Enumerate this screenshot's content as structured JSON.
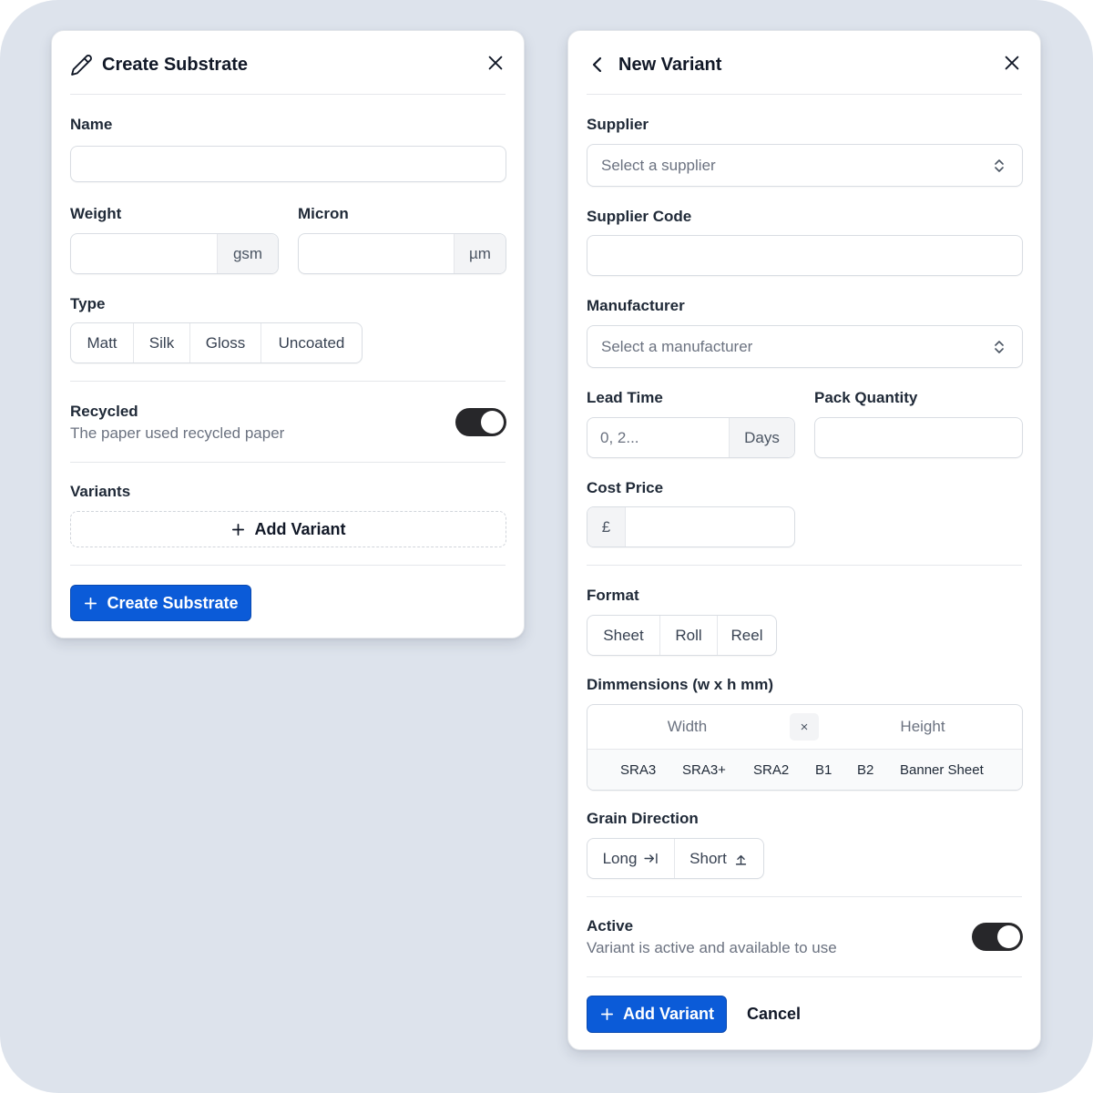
{
  "colors": {
    "background": "#dde3ec",
    "primary": "#0b5bd8",
    "toggle_on": "#27272a"
  },
  "create_substrate": {
    "title": "Create Substrate",
    "icons": {
      "title": "pencil-icon",
      "close": "close-icon"
    },
    "name": {
      "label": "Name",
      "value": ""
    },
    "weight": {
      "label": "Weight",
      "value": "",
      "unit": "gsm"
    },
    "micron": {
      "label": "Micron",
      "value": "",
      "unit": "µm"
    },
    "type": {
      "label": "Type",
      "options": [
        "Matt",
        "Silk",
        "Gloss",
        "Uncoated"
      ]
    },
    "recycled": {
      "label": "Recycled",
      "description": "The paper used recycled paper",
      "enabled": true
    },
    "variants": {
      "label": "Variants",
      "add_label": "Add Variant"
    },
    "submit_label": "Create Substrate"
  },
  "new_variant": {
    "title": "New Variant",
    "icons": {
      "back": "chevron-left-icon",
      "close": "close-icon"
    },
    "supplier": {
      "label": "Supplier",
      "placeholder": "Select a supplier"
    },
    "supplier_code": {
      "label": "Supplier Code",
      "value": ""
    },
    "manufacturer": {
      "label": "Manufacturer",
      "placeholder": "Select a manufacturer"
    },
    "lead_time": {
      "label": "Lead Time",
      "placeholder": "0, 2...",
      "unit": "Days"
    },
    "pack_quantity": {
      "label": "Pack Quantity",
      "value": ""
    },
    "cost_price": {
      "label": "Cost Price",
      "currency": "£",
      "value": ""
    },
    "format": {
      "label": "Format",
      "options": [
        "Sheet",
        "Roll",
        "Reel"
      ]
    },
    "dimensions": {
      "label": "Dimmensions (w x h mm)",
      "width_placeholder": "Width",
      "separator": "×",
      "height_placeholder": "Height",
      "presets": [
        "SRA3",
        "SRA3+",
        "SRA2",
        "B1",
        "B2",
        "Banner Sheet"
      ]
    },
    "grain_direction": {
      "label": "Grain Direction",
      "options": [
        {
          "label": "Long",
          "icon": "arrow-right-to-line-icon"
        },
        {
          "label": "Short",
          "icon": "arrow-up-to-line-icon"
        }
      ]
    },
    "active": {
      "label": "Active",
      "description": "Variant is active and available to use",
      "enabled": true
    },
    "submit_label": "Add Variant",
    "cancel_label": "Cancel"
  }
}
